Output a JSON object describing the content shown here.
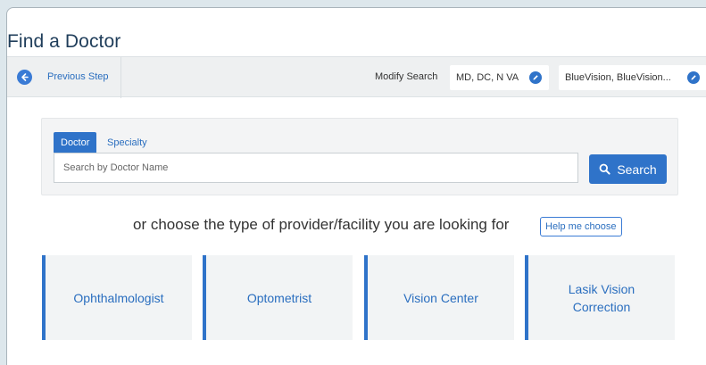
{
  "page": {
    "title": "Find a Doctor"
  },
  "subbar": {
    "previous_step": "Previous Step",
    "modify_search_label": "Modify Search",
    "filter_chips": [
      "MD, DC, N VA",
      "BlueVision, BlueVision..."
    ]
  },
  "search": {
    "tabs": [
      {
        "label": "Doctor",
        "active": true
      },
      {
        "label": "Specialty",
        "active": false
      }
    ],
    "input_value": "",
    "placeholder": "Search by Doctor Name",
    "button_label": "Search"
  },
  "provider_type": {
    "prompt": "or choose the type of provider/facility you are looking for",
    "help_label": "Help me choose",
    "cards": [
      "Ophthalmologist",
      "Optometrist",
      "Vision Center",
      "Lasik Vision Correction"
    ]
  },
  "colors": {
    "accent": "#2f73c9",
    "title": "#1f3d5a",
    "link": "#2a6ebf",
    "card_bg": "#f2f4f5"
  },
  "icons": {
    "back": "arrow-left-circle-icon",
    "edit": "pencil-icon",
    "search": "magnifier-icon"
  }
}
